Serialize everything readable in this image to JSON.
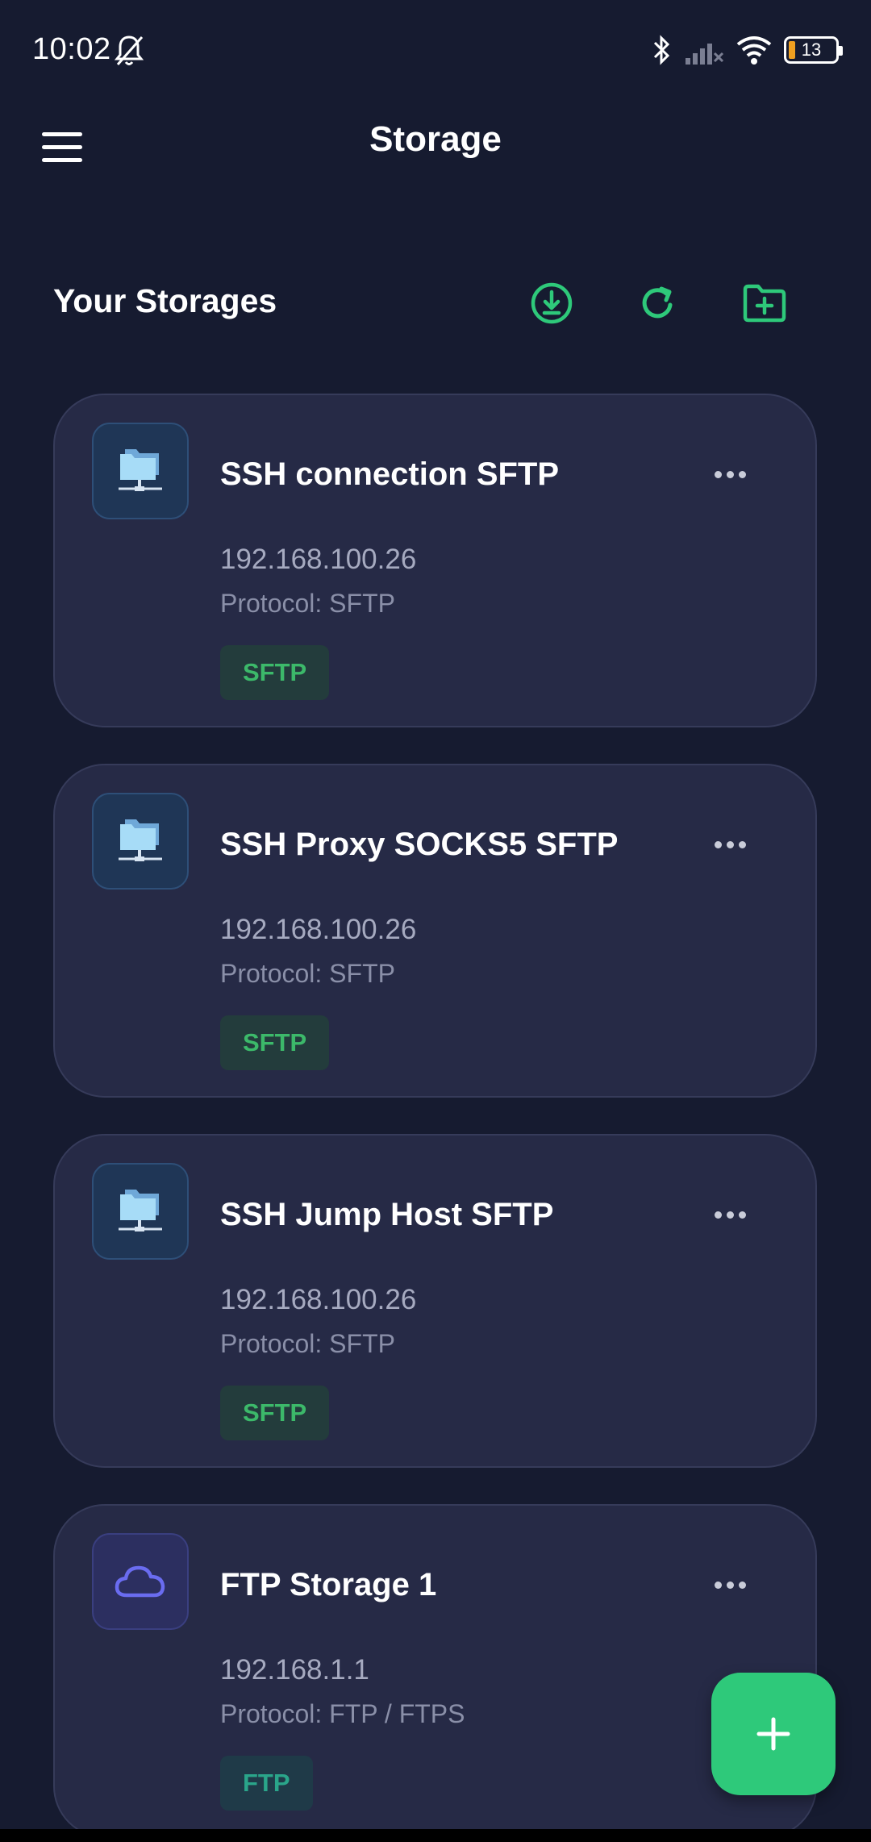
{
  "status_bar": {
    "time": "10:02",
    "battery_level": "13",
    "icons": [
      "bell-off-icon",
      "bluetooth-icon",
      "signal-off-icon",
      "wifi-icon",
      "battery-icon"
    ]
  },
  "app_bar": {
    "title": "Storage",
    "menu_icon": "hamburger-menu-icon"
  },
  "section": {
    "title": "Your Storages",
    "actions": [
      "download-icon",
      "refresh-icon",
      "folder-add-icon"
    ],
    "accent_color": "#2ec97a"
  },
  "storages": [
    {
      "name": "SSH connection SFTP",
      "host": "192.168.100.26",
      "protocol": "Protocol: SFTP",
      "badge": "SFTP",
      "icon": "network-folder-icon"
    },
    {
      "name": "SSH Proxy SOCKS5 SFTP",
      "host": "192.168.100.26",
      "protocol": "Protocol: SFTP",
      "badge": "SFTP",
      "icon": "network-folder-icon"
    },
    {
      "name": "SSH Jump Host SFTP",
      "host": "192.168.100.26",
      "protocol": "Protocol: SFTP",
      "badge": "SFTP",
      "icon": "network-folder-icon"
    },
    {
      "name": "FTP Storage 1",
      "host": "192.168.1.1",
      "protocol": "Protocol: FTP / FTPS",
      "badge": "FTP",
      "icon": "cloud-icon"
    }
  ],
  "fab": {
    "icon": "plus-icon"
  },
  "colors": {
    "background": "#161b30",
    "card": "#262a46",
    "sftp_badge_text": "#3cb96a",
    "ftp_badge_text": "#2aa58a"
  }
}
